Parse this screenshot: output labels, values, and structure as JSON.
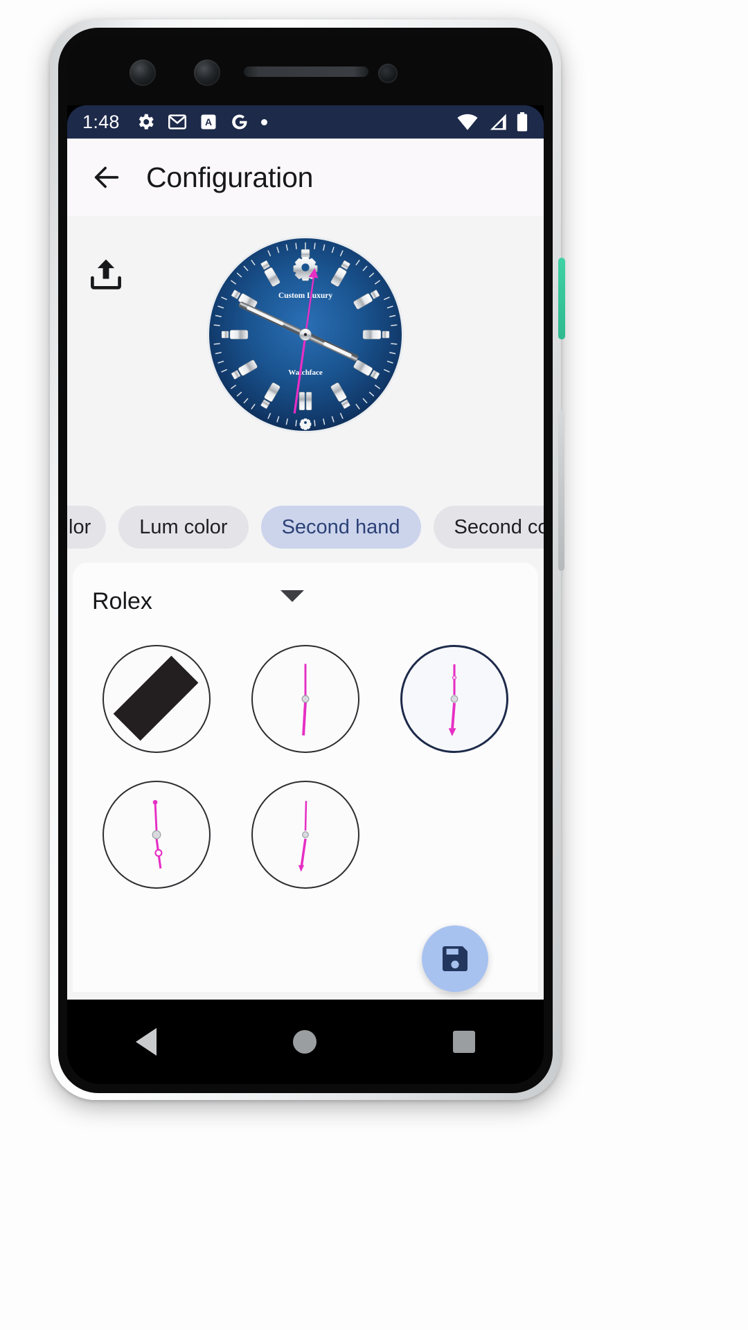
{
  "statusbar": {
    "time": "1:48",
    "left_icons": [
      "gear-icon",
      "gmail-icon",
      "a-badge-icon",
      "google-g-icon",
      "dot-icon"
    ],
    "right_icons": [
      "wifi-icon",
      "signal-icon",
      "battery-icon"
    ],
    "background_color": "#1d2a4a"
  },
  "appbar": {
    "back_label": "back-arrow",
    "title": "Configuration",
    "background_color": "#fbf8fb"
  },
  "preview": {
    "upload_icon": "upload-icon",
    "watchface": {
      "brand_text": "Custom Luxury",
      "sub_text": "Watchface",
      "dial_color": "#17508c",
      "dial_edge_color": "#0d2b52",
      "second_hand_color": "#e62fc4",
      "marker_color": "#dfe3e8",
      "hour_marker_glyph": "gear-icon"
    }
  },
  "chips": [
    {
      "label": "lor",
      "selected": false,
      "truncated": true
    },
    {
      "label": "Lum color",
      "selected": false,
      "truncated": false
    },
    {
      "label": "Second hand",
      "selected": true,
      "truncated": false
    },
    {
      "label": "Second color",
      "selected": false,
      "truncated": false
    }
  ],
  "chip_colors": {
    "unselected_bg": "#e4e3e8",
    "unselected_text": "#1f1f22",
    "selected_bg": "#ccd4ec",
    "selected_text": "#2c4176"
  },
  "picker": {
    "dropdown_value": "Rolex",
    "dropdown_icon": "chevron-down-icon",
    "options": [
      {
        "name": "none-slash",
        "style": "slash",
        "selected": false
      },
      {
        "name": "plain-needle",
        "style": "needle-plain",
        "selected": false
      },
      {
        "name": "arrow-needle",
        "style": "needle-arrow",
        "selected": true
      },
      {
        "name": "counterweight-needle",
        "style": "needle-counterweight",
        "selected": false
      },
      {
        "name": "tapered-needle",
        "style": "needle-tapered",
        "selected": false
      }
    ],
    "hand_color": "#e62fc4",
    "selected_ring_color": "#1d2a4a"
  },
  "fab": {
    "icon": "save-floppy-icon",
    "background_color": "#a8c2f0",
    "icon_color": "#23375e"
  },
  "navbar": {
    "items": [
      "back-triangle-icon",
      "home-circle-icon",
      "recents-square-icon"
    ]
  }
}
